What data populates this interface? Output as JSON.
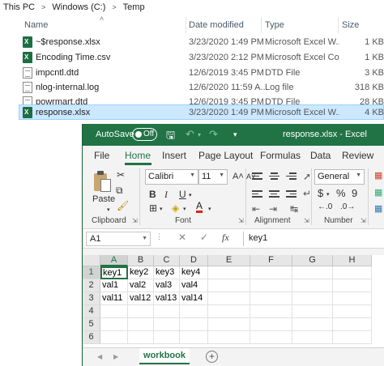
{
  "explorer": {
    "breadcrumb": [
      "This PC",
      "Windows (C:)",
      "Temp"
    ],
    "breadcrumb_sep": ">",
    "columns": {
      "name": "Name",
      "date": "Date modified",
      "type": "Type",
      "size": "Size"
    },
    "files": [
      {
        "name": "~$response.xlsx",
        "date": "3/23/2020 1:49 PM",
        "type": "Microsoft Excel W...",
        "size": "1 KB",
        "icon": "excel-file-icon"
      },
      {
        "name": "Encoding Time.csv",
        "date": "3/23/2020 2:12 PM",
        "type": "Microsoft Excel Co...",
        "size": "1 KB",
        "icon": "excel-file-icon"
      },
      {
        "name": "impcntl.dtd",
        "date": "12/6/2019 3:45 PM",
        "type": "DTD File",
        "size": "3 KB",
        "icon": "text-file-icon"
      },
      {
        "name": "nlog-internal.log",
        "date": "12/6/2020 11:59 A...",
        "type": "Log file",
        "size": "318 KB",
        "icon": "text-file-icon"
      },
      {
        "name": "powrmart.dtd",
        "date": "12/6/2019 3:45 PM",
        "type": "DTD File",
        "size": "28 KB",
        "icon": "text-file-icon"
      },
      {
        "name": "response.xlsx",
        "date": "3/23/2020 1:49 PM",
        "type": "Microsoft Excel W...",
        "size": "4 KB",
        "icon": "excel-file-icon",
        "selected": true
      }
    ]
  },
  "excel": {
    "autosave_label": "AutoSave",
    "autosave_state": "Off",
    "title": "response.xlsx  -  Excel",
    "tabs": [
      "File",
      "Home",
      "Insert",
      "Page Layout",
      "Formulas",
      "Data",
      "Review"
    ],
    "active_tab": "Home",
    "ribbon": {
      "paste_label": "Paste",
      "clipboard_label": "Clipboard",
      "font_name": "Calibri",
      "font_size": "11",
      "bold": "B",
      "italic": "I",
      "underline": "U",
      "font_grow": "A˄",
      "font_shrink": "A˅",
      "font_color_letter": "A",
      "font_label": "Font",
      "alignment_label": "Alignment",
      "number_format": "General",
      "currency_symbol": "$",
      "percent_symbol": "%",
      "comma_symbol": "9",
      "number_label": "Number"
    },
    "formula_bar": {
      "name_box": "A1",
      "cancel": "✕",
      "enter": "✓",
      "fx": "fx",
      "value": "key1"
    },
    "grid": {
      "columns": [
        "A",
        "B",
        "C",
        "D",
        "E",
        "F",
        "G",
        "H"
      ],
      "rows": [
        {
          "num": "1",
          "cells": [
            "key1",
            "key2",
            "key3",
            "key4",
            "",
            "",
            "",
            ""
          ]
        },
        {
          "num": "2",
          "cells": [
            "val1",
            "val2",
            "val3",
            "val4",
            "",
            "",
            "",
            ""
          ]
        },
        {
          "num": "3",
          "cells": [
            "val11",
            "val12",
            "val13",
            "val14",
            "",
            "",
            "",
            ""
          ]
        },
        {
          "num": "4",
          "cells": [
            "",
            "",
            "",
            "",
            "",
            "",
            "",
            ""
          ]
        },
        {
          "num": "5",
          "cells": [
            "",
            "",
            "",
            "",
            "",
            "",
            "",
            ""
          ]
        },
        {
          "num": "6",
          "cells": [
            "",
            "",
            "",
            "",
            "",
            "",
            "",
            ""
          ]
        }
      ]
    },
    "sheet_tab": "workbook",
    "add_sheet": "+",
    "colors": {
      "accent": "#217346",
      "selection": "#cce8ff"
    }
  }
}
